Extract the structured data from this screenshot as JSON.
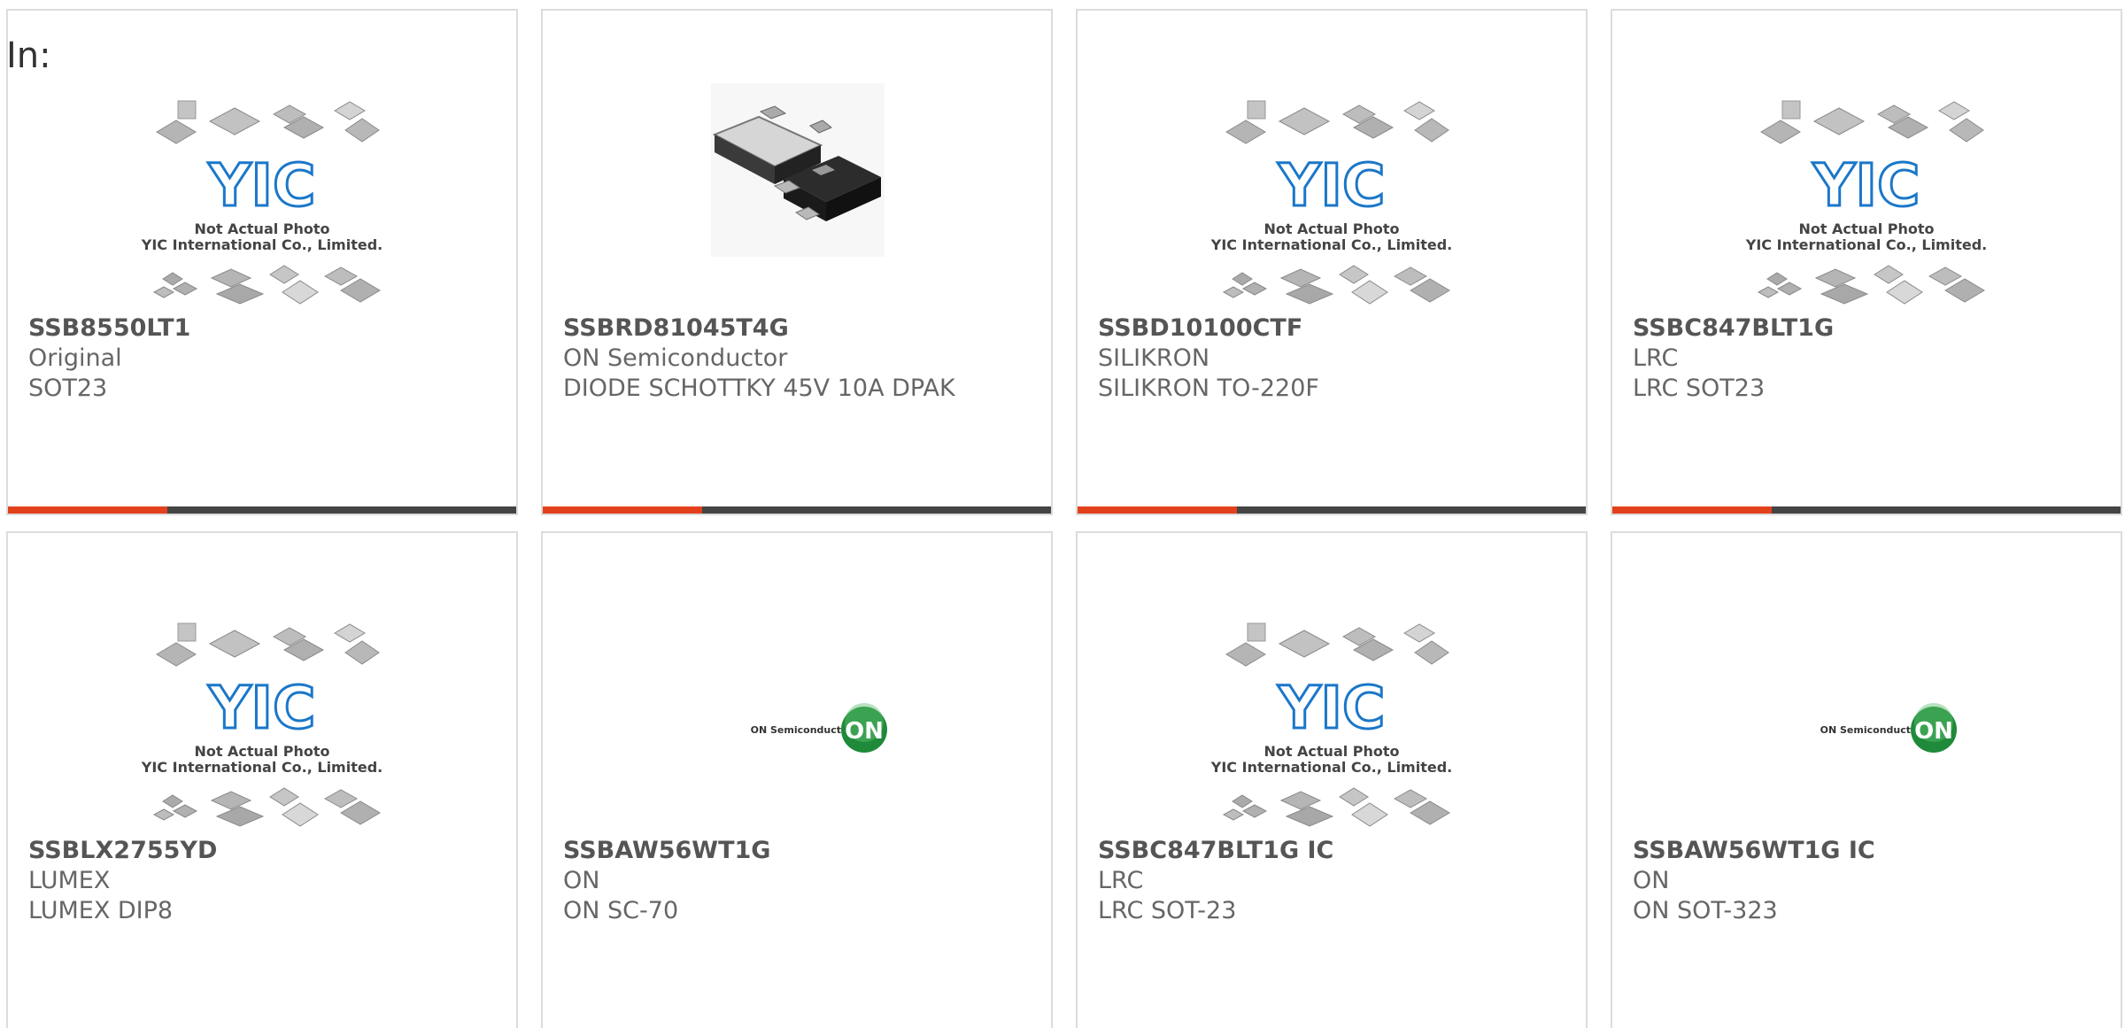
{
  "page": {
    "in_label": "In:"
  },
  "placeholder": {
    "logo_text": "YIC",
    "line1": "Not Actual Photo",
    "line2": "YIC International Co., Limited.",
    "logo_color": "#1a77c9"
  },
  "on_logo": {
    "wordmark": "ON Semiconductor",
    "registered": "®",
    "badge_text": "ON",
    "badge_color": "#1e8a3a"
  },
  "accent_color": "#e3411c",
  "products": [
    {
      "part_number": "SSB8550LT1",
      "manufacturer": "Original",
      "description": "SOT23",
      "image": "yic-placeholder"
    },
    {
      "part_number": "SSBRD81045T4G",
      "manufacturer": "ON Semiconductor",
      "description": "DIODE SCHOTTKY 45V 10A DPAK",
      "image": "dpak-package-photo"
    },
    {
      "part_number": "SSBD10100CTF",
      "manufacturer": "SILIKRON",
      "description": "SILIKRON TO-220F",
      "image": "yic-placeholder"
    },
    {
      "part_number": "SSBC847BLT1G",
      "manufacturer": "LRC",
      "description": "LRC SOT23",
      "image": "yic-placeholder"
    },
    {
      "part_number": "SSBLX2755YD",
      "manufacturer": "LUMEX",
      "description": "LUMEX DIP8",
      "image": "yic-placeholder"
    },
    {
      "part_number": "SSBAW56WT1G",
      "manufacturer": "ON",
      "description": "ON SC-70",
      "image": "on-semiconductor-logo"
    },
    {
      "part_number": "SSBC847BLT1G IC",
      "manufacturer": "LRC",
      "description": "LRC SOT-23",
      "image": "yic-placeholder"
    },
    {
      "part_number": "SSBAW56WT1G IC",
      "manufacturer": "ON",
      "description": "ON SOT-323",
      "image": "on-semiconductor-logo"
    }
  ]
}
